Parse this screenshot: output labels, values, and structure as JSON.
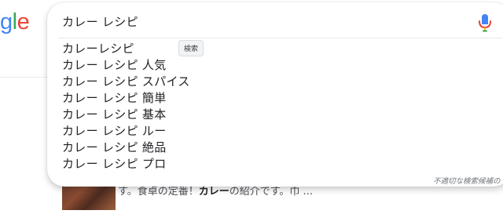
{
  "logo": {
    "part1": "g",
    "part2": "l",
    "part3": "e"
  },
  "search": {
    "query": "カレー レシピ",
    "tooltip": "検索"
  },
  "suggestions": [
    "カレーレシピ",
    "カレー レシピ 人気",
    "カレー レシピ スパイス",
    "カレー レシピ 簡単",
    "カレー レシピ 基本",
    "カレー レシピ ルー",
    "カレー レシピ 絶品",
    "カレー レシピ プロ"
  ],
  "report_link": "不適切な検索候補の",
  "background_result": {
    "snippet_pre": "す。食卓の定番！",
    "snippet_bold": "カレー",
    "snippet_post": "の紹介です。巾 ..."
  },
  "colors": {
    "mic_blue": "#4285f4",
    "mic_red": "#ea4335",
    "mic_yellow": "#fbbc04",
    "mic_green": "#34a853"
  },
  "icons": [
    "microphone-icon"
  ]
}
